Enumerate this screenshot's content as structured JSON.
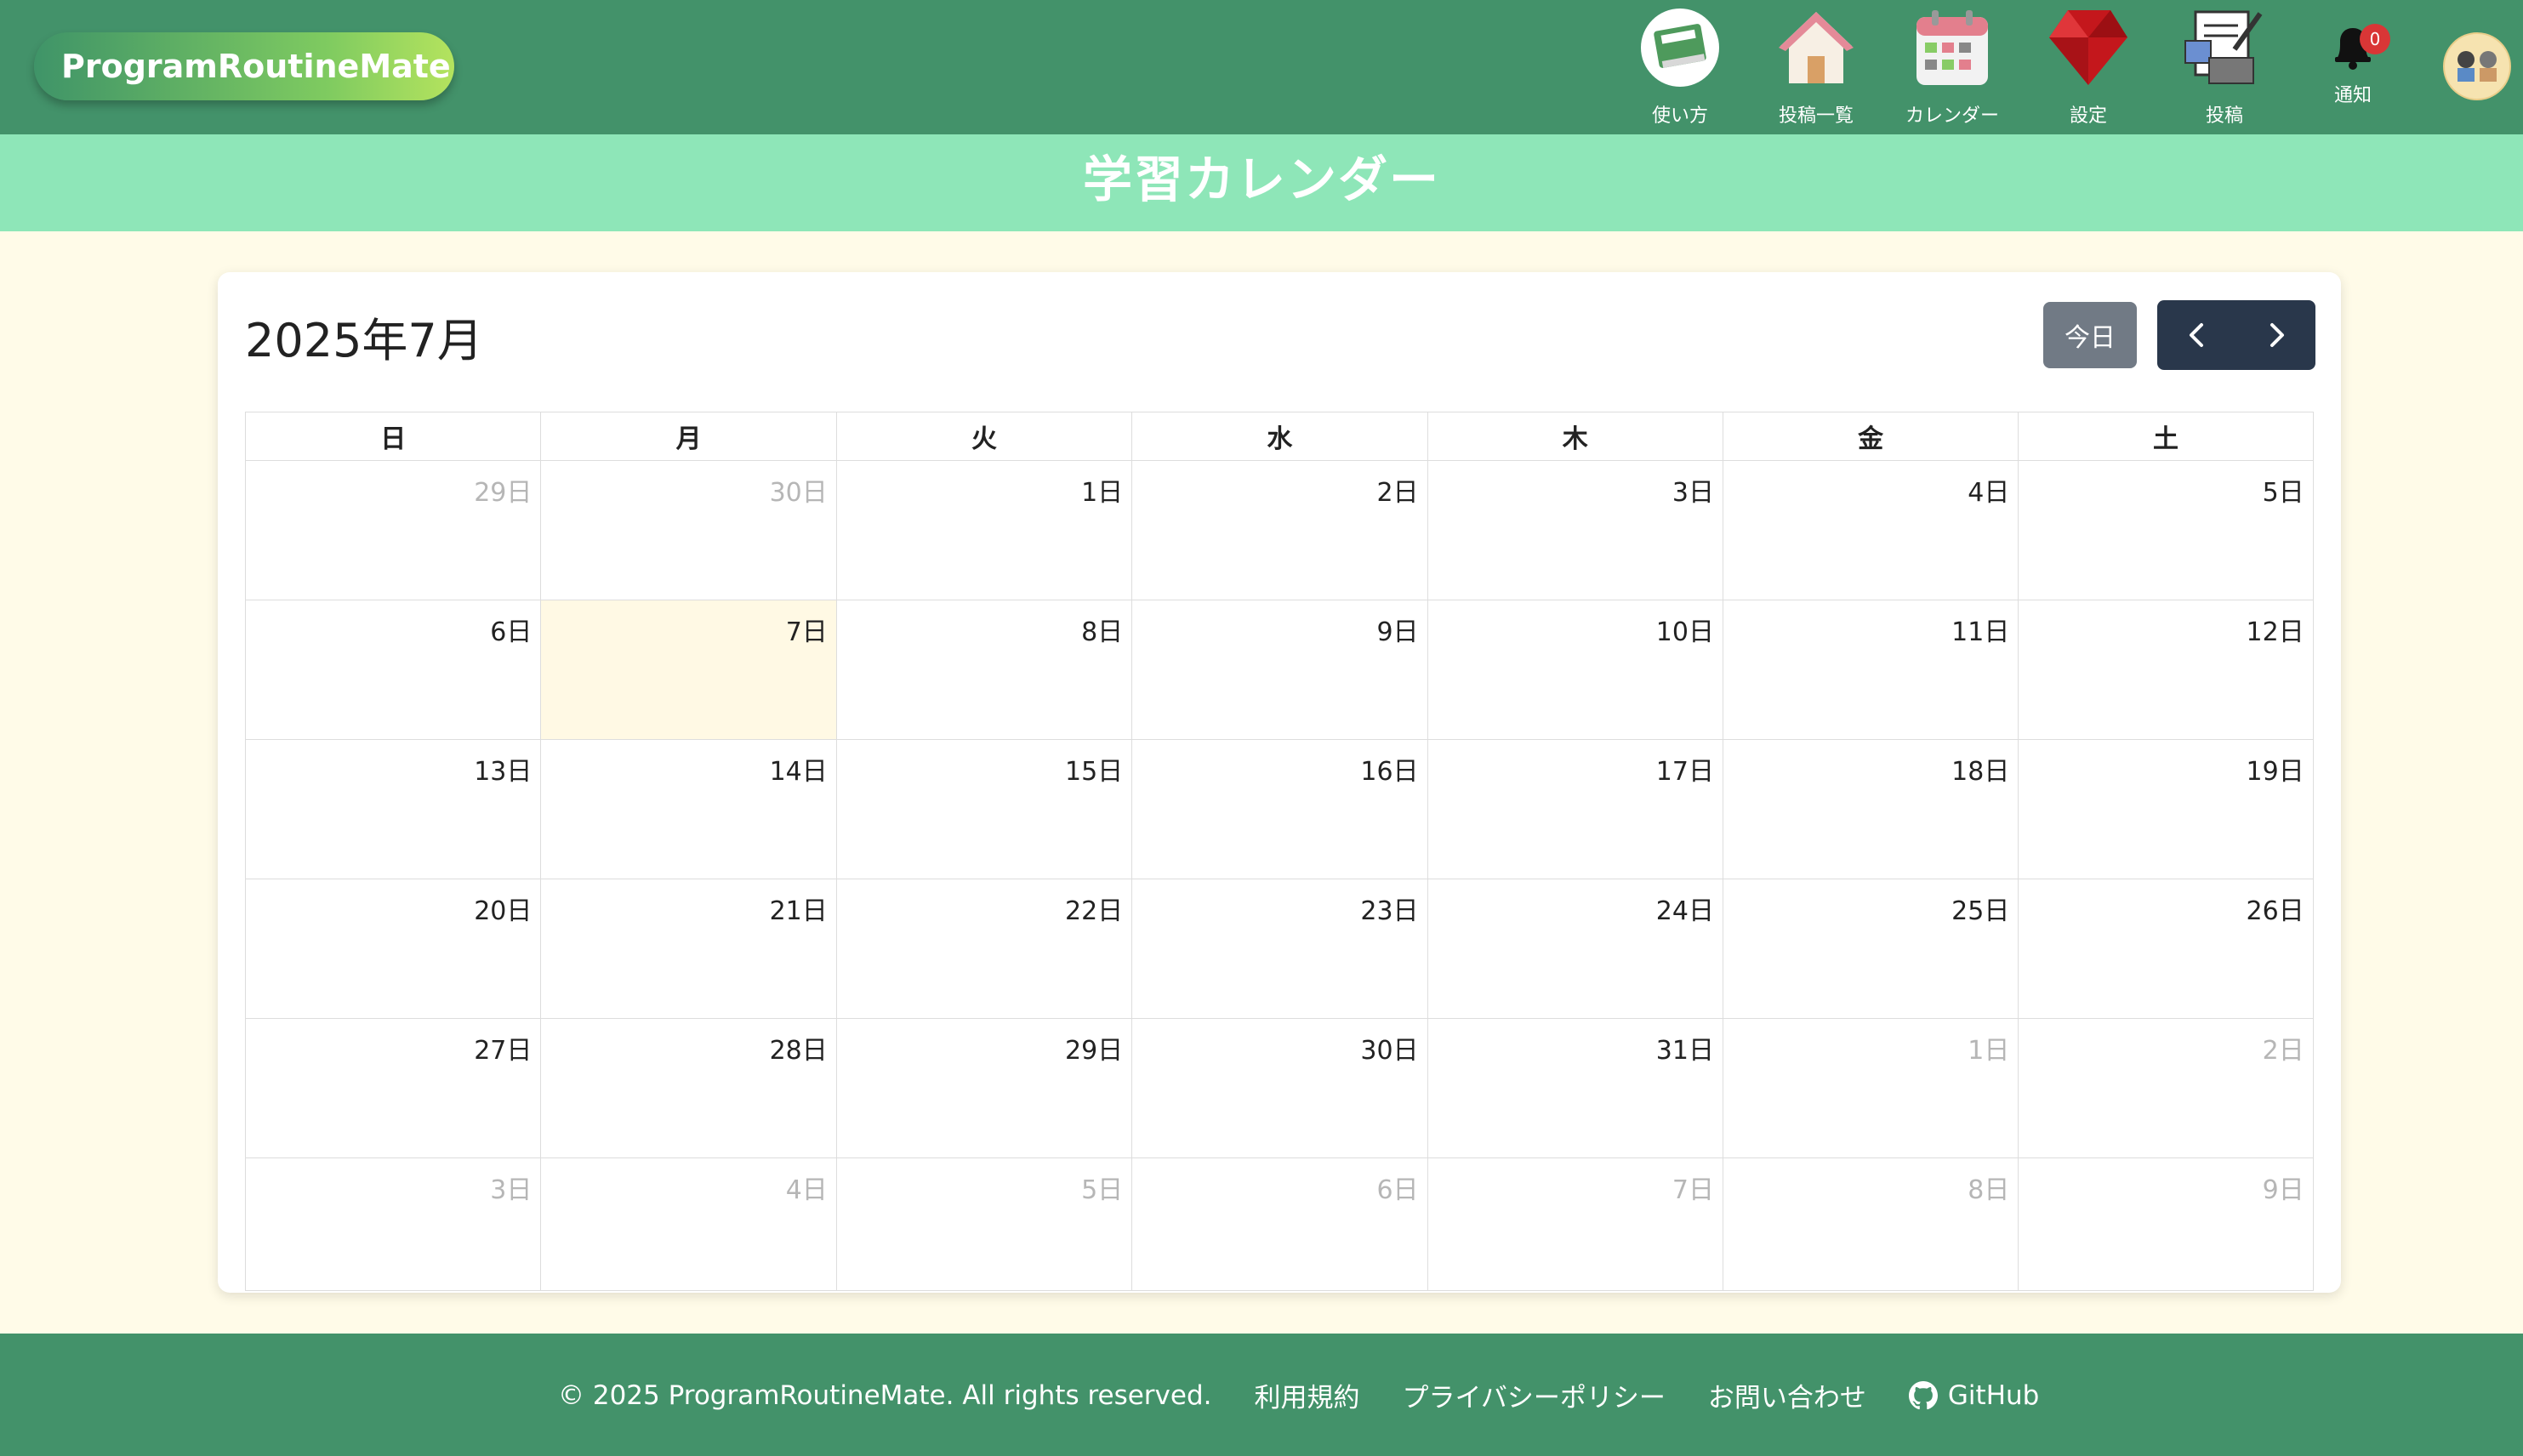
{
  "app": {
    "logo": "ProgramRoutineMate"
  },
  "nav": {
    "usage": "使い方",
    "posts": "投稿一覧",
    "calendar": "カレンダー",
    "settings": "設定",
    "post": "投稿",
    "notifications": "通知",
    "notification_count": "0"
  },
  "page": {
    "title": "学習カレンダー"
  },
  "calendar": {
    "month": "2025年7月",
    "today_label": "今日",
    "weekdays": [
      "日",
      "月",
      "火",
      "水",
      "木",
      "金",
      "土"
    ],
    "weeks": [
      [
        {
          "d": "29日",
          "o": true
        },
        {
          "d": "30日",
          "o": true
        },
        {
          "d": "1日"
        },
        {
          "d": "2日"
        },
        {
          "d": "3日"
        },
        {
          "d": "4日"
        },
        {
          "d": "5日"
        }
      ],
      [
        {
          "d": "6日"
        },
        {
          "d": "7日",
          "t": true
        },
        {
          "d": "8日"
        },
        {
          "d": "9日"
        },
        {
          "d": "10日"
        },
        {
          "d": "11日"
        },
        {
          "d": "12日"
        }
      ],
      [
        {
          "d": "13日"
        },
        {
          "d": "14日"
        },
        {
          "d": "15日"
        },
        {
          "d": "16日"
        },
        {
          "d": "17日"
        },
        {
          "d": "18日"
        },
        {
          "d": "19日"
        }
      ],
      [
        {
          "d": "20日"
        },
        {
          "d": "21日"
        },
        {
          "d": "22日"
        },
        {
          "d": "23日"
        },
        {
          "d": "24日"
        },
        {
          "d": "25日"
        },
        {
          "d": "26日"
        }
      ],
      [
        {
          "d": "27日"
        },
        {
          "d": "28日"
        },
        {
          "d": "29日"
        },
        {
          "d": "30日"
        },
        {
          "d": "31日"
        },
        {
          "d": "1日",
          "o": true
        },
        {
          "d": "2日",
          "o": true
        }
      ],
      [
        {
          "d": "3日",
          "o": true
        },
        {
          "d": "4日",
          "o": true
        },
        {
          "d": "5日",
          "o": true
        },
        {
          "d": "6日",
          "o": true
        },
        {
          "d": "7日",
          "o": true
        },
        {
          "d": "8日",
          "o": true
        },
        {
          "d": "9日",
          "o": true
        }
      ]
    ]
  },
  "footer": {
    "copyright": "© 2025 ProgramRoutineMate. All rights reserved.",
    "terms": "利用規約",
    "privacy": "プライバシーポリシー",
    "contact": "お問い合わせ",
    "github": "GitHub"
  },
  "colors": {
    "header": "#43926a",
    "title_band": "#8ee6b8",
    "page_bg": "#fffbe8",
    "today_cell": "#fff9e4",
    "nav_button": "#29374b",
    "today_button": "#717a85"
  }
}
